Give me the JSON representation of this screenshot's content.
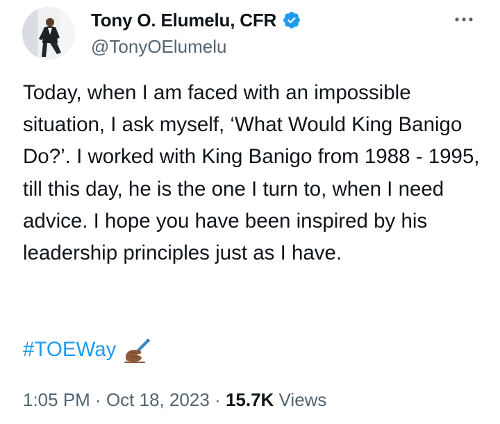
{
  "author": {
    "display_name": "Tony O. Elumelu, CFR",
    "handle": "@TonyOElumelu",
    "verified": true,
    "avatar_icon": "profile-photo"
  },
  "tweet": {
    "text": "Today, when I am faced with an impossible situation, I ask myself, ‘What Would King Banigo Do?’. I worked with King Banigo from 1988 - 1995, till this day, he is the one I turn to, when I need advice. I hope you have been inspired by his leadership principles just as I have.",
    "hashtag": "#TOEWay",
    "emoji_icon": "writing-hand-icon"
  },
  "meta": {
    "time": "1:05 PM",
    "separator1": " · ",
    "date": "Oct 18, 2023",
    "separator2": " · ",
    "views_count": "15.7K",
    "views_label": " Views"
  },
  "colors": {
    "accent": "#1d9bf0",
    "secondary_text": "#536471",
    "primary_text": "#0f1419"
  }
}
